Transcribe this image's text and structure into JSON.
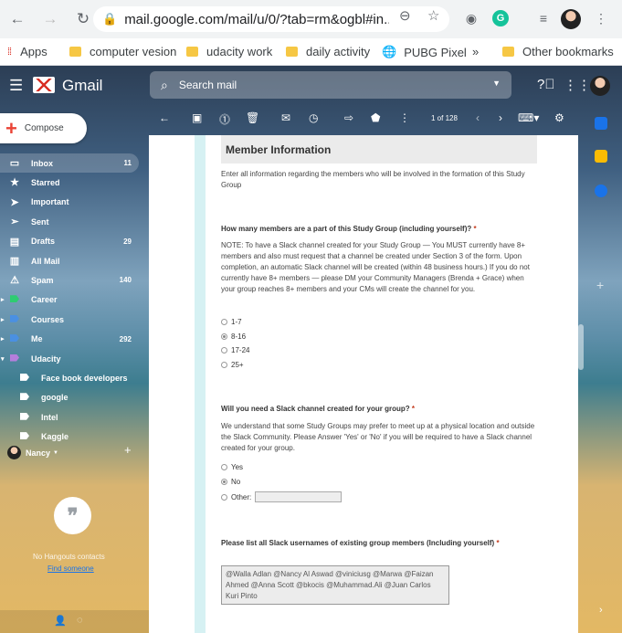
{
  "browser": {
    "url": "mail.google.com/mail/u/0/?tab=rm&ogbl#in...",
    "bookmarks": [
      {
        "label": "Apps",
        "type": "apps"
      },
      {
        "label": "computer vesion",
        "type": "folder"
      },
      {
        "label": "udacity work",
        "type": "folder"
      },
      {
        "label": "daily activity",
        "type": "folder"
      },
      {
        "label": "PUBG Pixel",
        "type": "globe"
      }
    ],
    "more_chevron": "»",
    "other_bookmarks": "Other bookmarks"
  },
  "gmail": {
    "app_title": "Gmail",
    "search_placeholder": "Search mail",
    "compose_label": "Compose",
    "sidebar": [
      {
        "label": "Inbox",
        "count": "11",
        "icon": "inbox-icon"
      },
      {
        "label": "Starred",
        "count": "",
        "icon": "star-icon"
      },
      {
        "label": "Important",
        "count": "",
        "icon": "important-icon"
      },
      {
        "label": "Sent",
        "count": "",
        "icon": "send-icon"
      },
      {
        "label": "Drafts",
        "count": "29",
        "icon": "draft-icon"
      },
      {
        "label": "All Mail",
        "count": "",
        "icon": "all-mail-icon"
      },
      {
        "label": "Spam",
        "count": "140",
        "icon": "spam-icon"
      },
      {
        "label": "Career",
        "count": "",
        "icon": "label-icon",
        "color": "#2ecc71"
      },
      {
        "label": "Courses",
        "count": "",
        "icon": "label-icon",
        "color": "#4a90e2"
      },
      {
        "label": "Me",
        "count": "292",
        "icon": "label-icon",
        "color": "#4a90e2"
      },
      {
        "label": "Udacity",
        "count": "",
        "icon": "label-icon",
        "color": "#b57edc"
      },
      {
        "label": "Face book developers",
        "count": "",
        "icon": "label-icon",
        "color": "#ffffff"
      },
      {
        "label": "google",
        "count": "",
        "icon": "label-icon",
        "color": "#ffffff"
      },
      {
        "label": "Intel",
        "count": "",
        "icon": "label-icon",
        "color": "#ffffff"
      },
      {
        "label": "Kaggle",
        "count": "",
        "icon": "label-icon",
        "color": "#ffffff"
      }
    ],
    "hangouts_user": "Nancy",
    "no_hangouts": "No Hangouts contacts",
    "find_someone": "Find someone",
    "pager": "1 of 128"
  },
  "form": {
    "section_title": "Member Information",
    "section_desc": "Enter all information regarding the members who will be involved in the formation of this Study Group",
    "q1": {
      "title": "How many members are a part of this Study Group (including yourself)?",
      "req": "*",
      "note": "NOTE: To have a Slack channel created for your Study Group — You MUST currently have 8+ members and also must request that a channel be created under Section 3 of the form. Upon completion, an automatic Slack channel will be created (within 48 business hours.) If you do not currently have 8+ members — please DM your Community Managers (Brenda + Grace) when your group reaches 8+ members and your CMs will create the channel for you.",
      "options": [
        "1-7",
        "8-16",
        "17-24",
        "25+"
      ],
      "selected": 1
    },
    "q2": {
      "title": "Will you need a Slack channel created for your group?",
      "req": "*",
      "desc": "We understand that some Study Groups may prefer to meet up at a physical location and outside the Slack Community. Please Answer 'Yes' or 'No' if you will be required to have a Slack channel created for your group.",
      "options": [
        "Yes",
        "No",
        "Other:"
      ],
      "selected": 1
    },
    "q3": {
      "title": "Please list all Slack usernames of existing group members (Including yourself)",
      "req": "*",
      "value": "@Walla Adlan @Nancy Al Aswad @viniciusg @Marwa @Faizan Ahmed @Anna Scott @bkocis @Muhammad.Ali @Juan Carlos Kuri Pinto"
    }
  }
}
